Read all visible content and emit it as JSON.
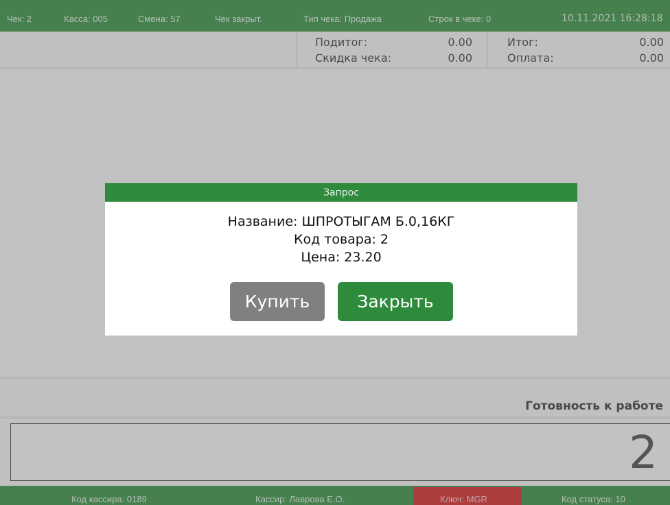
{
  "topbar": {
    "check": "Чек: 2",
    "register": "Касса: 005",
    "shift": "Смена: 57",
    "check_state": "Чек закрыт.",
    "check_type": "Тип чека: Продажа",
    "lines": "Строк в чеке: 0",
    "datetime": "10.11.2021 16:28:18"
  },
  "totals": {
    "subtotal_label": "Подитог:",
    "subtotal_value": "0.00",
    "discount_label": "Скидка чека:",
    "discount_value": "0.00",
    "total_label": "Итог:",
    "total_value": "0.00",
    "payment_label": "Оплата:",
    "payment_value": "0.00"
  },
  "status": {
    "ready_text": "Готовность к работе"
  },
  "display": {
    "value": "2"
  },
  "bottombar": {
    "cashier_code": "Код кассира: 0189",
    "cashier": "Кассир: Лаврова Е.О.",
    "key": "Ключ: MGR",
    "status_code": "Код статуса: 10"
  },
  "modal": {
    "title": "Запрос",
    "line_name": "Название: ШПРОТЫГАМ Б.0,16КГ",
    "line_code": "Код товара: 2",
    "line_price": "Цена: 23.20",
    "buy_label": "Купить",
    "close_label": "Закрыть"
  },
  "colors": {
    "brand_green": "#2e8b3c",
    "button_gray": "#808080",
    "key_red": "#d42020"
  }
}
